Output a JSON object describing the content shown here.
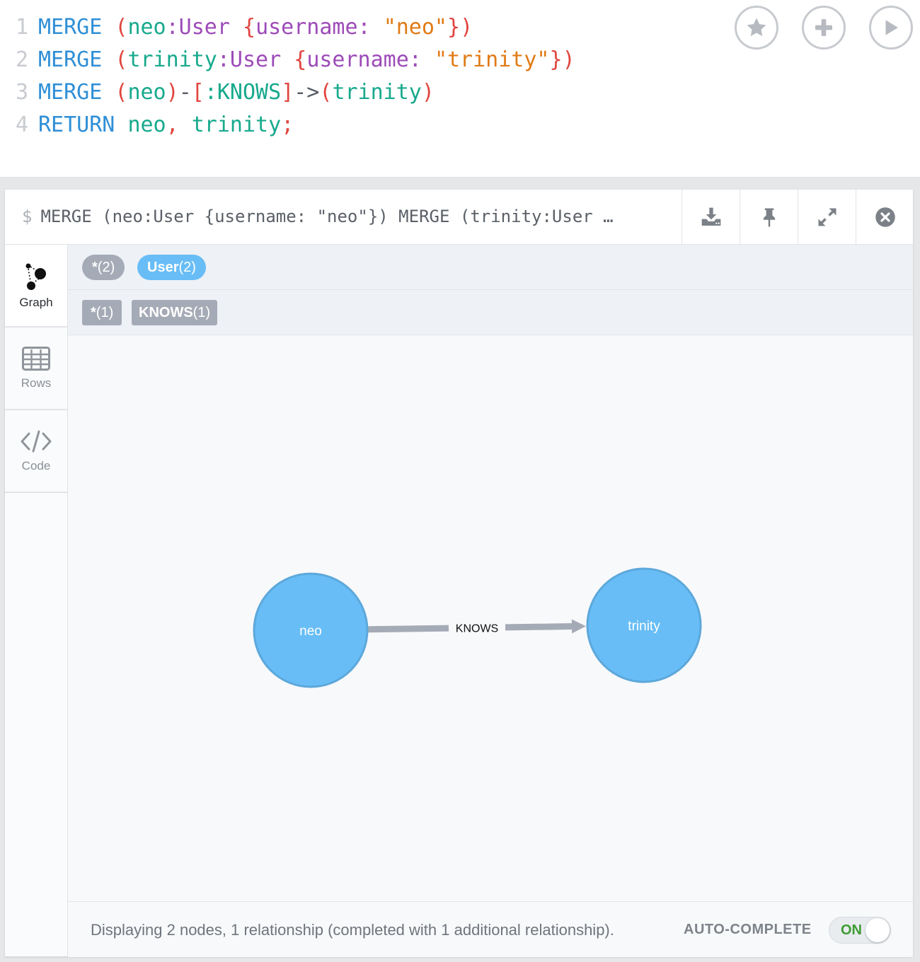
{
  "editor": {
    "lines": [
      {
        "n": "1",
        "tokens": [
          [
            "kw",
            "MERGE"
          ],
          [
            "plain",
            " "
          ],
          [
            "paren",
            "("
          ],
          [
            "var",
            "neo"
          ],
          [
            "label",
            ":User"
          ],
          [
            "plain",
            " "
          ],
          [
            "punct",
            "{"
          ],
          [
            "key",
            "username:"
          ],
          [
            "plain",
            " "
          ],
          [
            "str",
            "\"neo\""
          ],
          [
            "punct",
            "}"
          ],
          [
            "paren",
            ")"
          ]
        ]
      },
      {
        "n": "2",
        "tokens": [
          [
            "kw",
            "MERGE"
          ],
          [
            "plain",
            " "
          ],
          [
            "paren",
            "("
          ],
          [
            "var",
            "trinity"
          ],
          [
            "label",
            ":User"
          ],
          [
            "plain",
            " "
          ],
          [
            "punct",
            "{"
          ],
          [
            "key",
            "username:"
          ],
          [
            "plain",
            " "
          ],
          [
            "str",
            "\"trinity\""
          ],
          [
            "punct",
            "}"
          ],
          [
            "paren",
            ")"
          ]
        ]
      },
      {
        "n": "3",
        "tokens": [
          [
            "kw",
            "MERGE"
          ],
          [
            "plain",
            " "
          ],
          [
            "paren",
            "("
          ],
          [
            "var",
            "neo"
          ],
          [
            "paren",
            ")"
          ],
          [
            "plain",
            "-"
          ],
          [
            "paren",
            "["
          ],
          [
            "var",
            ":KNOWS"
          ],
          [
            "paren",
            "]"
          ],
          [
            "plain",
            "->"
          ],
          [
            "paren",
            "("
          ],
          [
            "var",
            "trinity"
          ],
          [
            "paren",
            ")"
          ]
        ]
      },
      {
        "n": "4",
        "tokens": [
          [
            "kw",
            "RETURN"
          ],
          [
            "plain",
            " "
          ],
          [
            "var",
            "neo"
          ],
          [
            "punct",
            ","
          ],
          [
            "plain",
            " "
          ],
          [
            "var",
            "trinity"
          ],
          [
            "punct",
            ";"
          ]
        ]
      }
    ],
    "buttons": [
      "star-icon",
      "plus-icon",
      "play-icon"
    ]
  },
  "frame": {
    "dollar": "$",
    "title": "MERGE (neo:User {username: \"neo\"}) MERGE (trinity:User …",
    "header_buttons": [
      "download-icon",
      "pin-icon",
      "expand-icon",
      "close-icon"
    ]
  },
  "sidebar": {
    "graph": "Graph",
    "rows": "Rows",
    "code": "Code"
  },
  "legend": {
    "node_all_label": "*",
    "node_all_count": "(2)",
    "node_user_label": "User",
    "node_user_count": "(2)",
    "rel_all_label": "*",
    "rel_all_count": "(1)",
    "rel_knows_label": "KNOWS",
    "rel_knows_count": "(1)",
    "colors": {
      "gray": "#a5abb6",
      "blue": "#68bdf6"
    }
  },
  "graph": {
    "nodes": [
      {
        "id": "neo",
        "caption": "neo",
        "color": "#68bdf6"
      },
      {
        "id": "trinity",
        "caption": "trinity",
        "color": "#68bdf6"
      }
    ],
    "relationships": [
      {
        "from": "neo",
        "to": "trinity",
        "type": "KNOWS"
      }
    ]
  },
  "status": {
    "text": "Displaying 2 nodes, 1 relationship (completed with 1 additional relationship).",
    "auto_label": "AUTO-COMPLETE",
    "toggle": "ON"
  }
}
